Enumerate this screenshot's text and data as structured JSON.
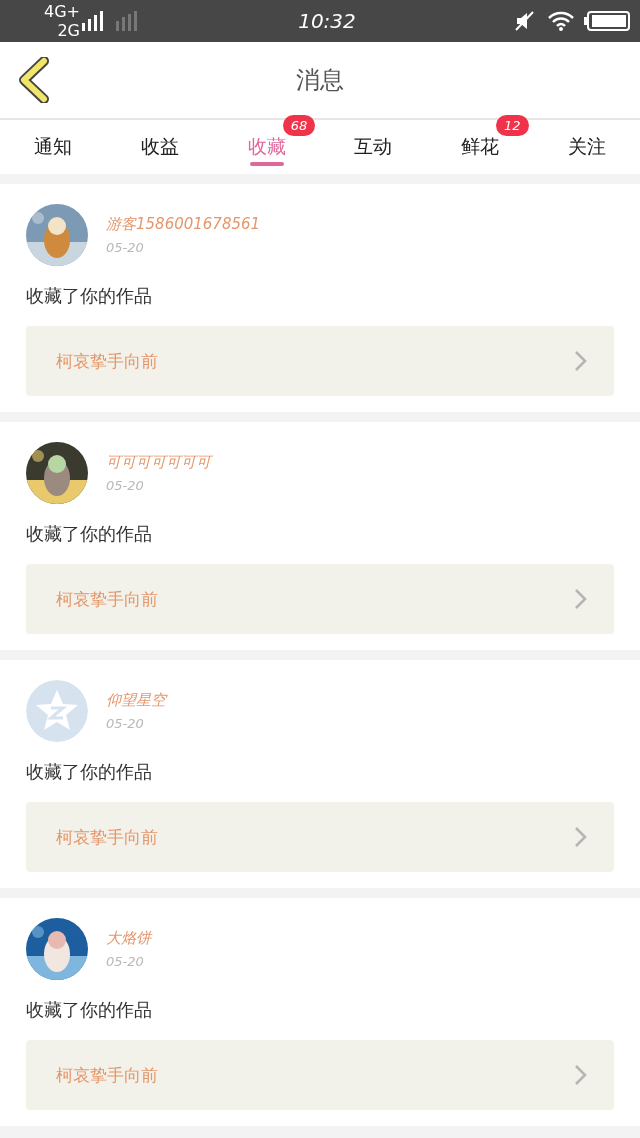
{
  "status_bar": {
    "network_1": "4G+",
    "network_2": "2G",
    "time": "10:32"
  },
  "header": {
    "title": "消息"
  },
  "tabs": [
    {
      "label": "通知",
      "selected": false
    },
    {
      "label": "收益",
      "selected": false
    },
    {
      "label": "收藏",
      "selected": true,
      "badge": "68"
    },
    {
      "label": "互动",
      "selected": false
    },
    {
      "label": "鲜花",
      "selected": false,
      "badge": "12"
    },
    {
      "label": "关注",
      "selected": false
    }
  ],
  "messages": [
    {
      "kind": "picture",
      "user": "游客1586001678561",
      "date": "05-20",
      "text": "收藏了你的作品",
      "work": "柯哀挚手向前"
    },
    {
      "kind": "picture",
      "user": "可可可可可可可",
      "date": "05-20",
      "text": "收藏了你的作品",
      "work": "柯哀挚手向前"
    },
    {
      "kind": "default",
      "user": "仰望星空",
      "date": "05-20",
      "text": "收藏了你的作品",
      "work": "柯哀挚手向前"
    },
    {
      "kind": "picture",
      "user": "大烙饼",
      "date": "05-20",
      "text": "收藏了你的作品",
      "work": "柯哀挚手向前"
    }
  ]
}
